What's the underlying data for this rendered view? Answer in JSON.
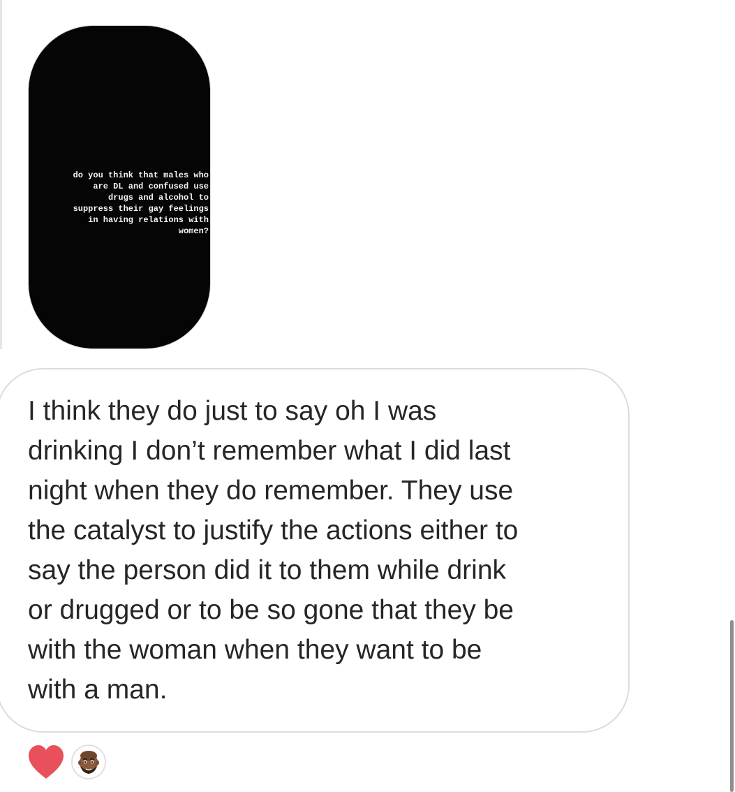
{
  "story": {
    "text": "do you think that males who\nare DL and confused use\ndrugs and alcohol to\nsuppress their gay feelings\nin having relations with\nwomen?"
  },
  "message": {
    "text": "I think they do just to say oh I was\ndrinking I don’t remember what I did last\nnight when they do remember. They use\nthe catalyst to justify the actions either to\nsay the person did it to them while drink\nor drugged or to be so gone that they be\nwith the woman when they want to be\nwith a man."
  },
  "reactions": {
    "emoji_icon": "heart-icon",
    "heart_color": "#e8505b",
    "reactor_avatar": "memoji-avatar"
  }
}
